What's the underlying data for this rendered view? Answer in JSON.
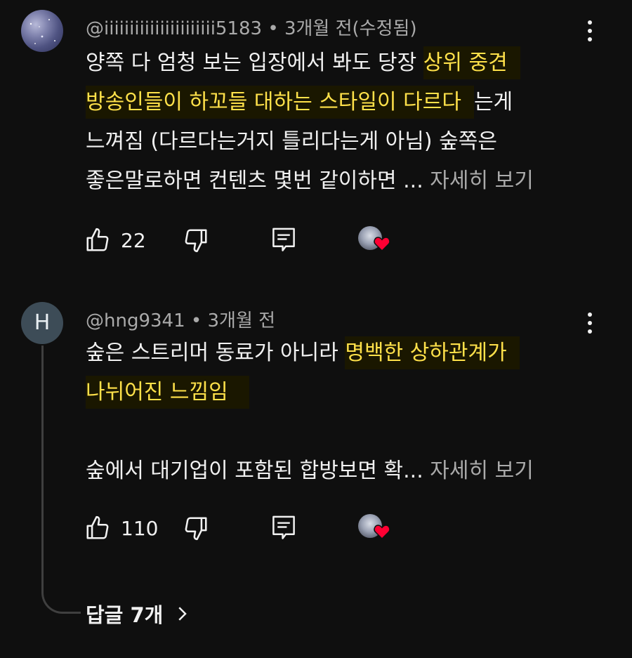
{
  "comments": [
    {
      "handle": "@iiiiiiiiiiiiiiiiiiiiii5183",
      "time": "3개월 전(수정됨)",
      "lines": {
        "l1_plain": "양쪽 다 엄청 보는 입장에서 봐도 당장 ",
        "l1_hl": "상위 중견",
        "l2_hl": "방송인들이 하꼬들 대하는 스타일이 다르다",
        "l2_plain": "는게",
        "l3": "느껴짐 (다르다는거지 틀리다는게 아님) 숲쪽은",
        "l4": "좋은말로하면 컨텐츠 몇번 같이하면 ... "
      },
      "more": "자세히 보기",
      "likes": "22",
      "avatar_icon": "space-avatar-icon"
    },
    {
      "handle": "@hng9341",
      "time": "3개월 전",
      "avatar_letter": "H",
      "lines": {
        "l1_plain": "숲은 스트리머 동료가 아니라 ",
        "l1_hl": "명백한 상하관계가",
        "l2_hl": "나뉘어진 느낌임",
        "l4": "숲에서 대기업이 포함된 합방보면 확... "
      },
      "more": "자세히 보기",
      "likes": "110"
    }
  ],
  "replies_label": "답글 7개",
  "colors": {
    "background": "#0f0f0f",
    "highlight_text": "#ffe14a",
    "secondary_text": "#aaaaaa",
    "heart": "#ff0033"
  }
}
